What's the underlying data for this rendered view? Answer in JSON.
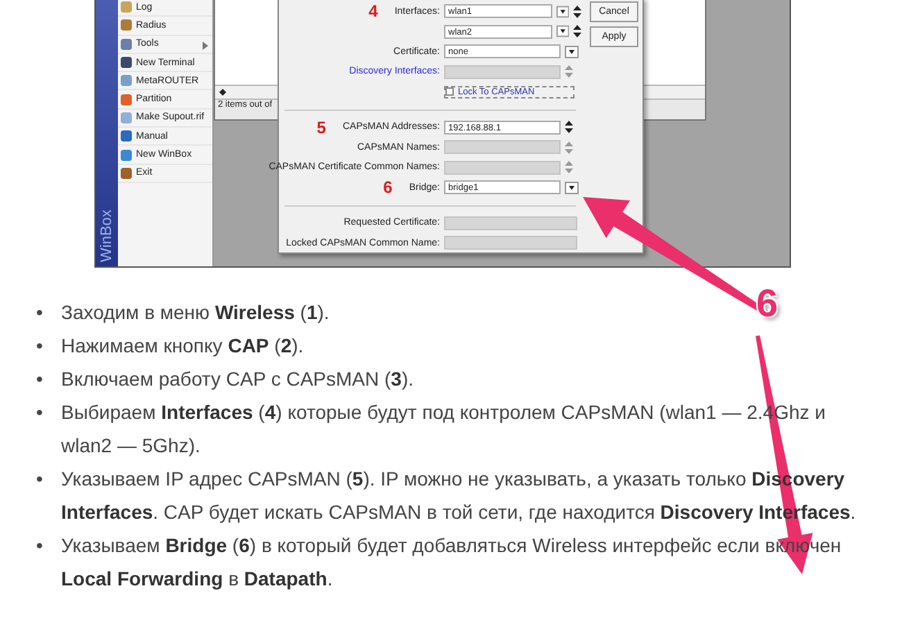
{
  "winbox": {
    "brand": "WinBox",
    "menu": [
      {
        "label": "Log",
        "submenu": false
      },
      {
        "label": "Radius",
        "submenu": false
      },
      {
        "label": "Tools",
        "submenu": true
      },
      {
        "label": "New Terminal",
        "submenu": false
      },
      {
        "label": "MetaROUTER",
        "submenu": false
      },
      {
        "label": "Partition",
        "submenu": false
      },
      {
        "label": "Make Supout.rif",
        "submenu": false
      },
      {
        "label": "Manual",
        "submenu": false
      },
      {
        "label": "New WinBox",
        "submenu": false
      },
      {
        "label": "Exit",
        "submenu": false
      }
    ],
    "list_window": {
      "status": "2 items out of"
    }
  },
  "dialog": {
    "rows": [
      {
        "kind": "dropdown",
        "number": "4",
        "label": "Interfaces:",
        "value": "wlan1",
        "disabled": false
      },
      {
        "kind": "dropdown",
        "value": "wlan2",
        "disabled": false
      },
      {
        "kind": "select",
        "label": "Certificate:",
        "value": "none",
        "disabled": false
      },
      {
        "kind": "spin",
        "link": "Discovery Interfaces:",
        "disabled": true
      },
      {
        "kind": "checkbox",
        "label": "Lock To CAPsMAN",
        "checked": false
      },
      {
        "kind": "separator"
      },
      {
        "kind": "spin",
        "number": "5",
        "label": "CAPsMAN Addresses:",
        "value": "192.168.88.1",
        "disabled": false
      },
      {
        "kind": "spin",
        "label": "CAPsMAN Names:",
        "disabled": true
      },
      {
        "kind": "spin",
        "label": "CAPsMAN Certificate Common Names:",
        "disabled": true
      },
      {
        "kind": "select",
        "number": "6",
        "label": "Bridge:",
        "value": "bridge1",
        "disabled": false
      },
      {
        "kind": "separator"
      },
      {
        "kind": "plain",
        "label": "Requested Certificate:",
        "disabled": true
      },
      {
        "kind": "plain",
        "label": "Locked CAPsMAN Common Name:",
        "disabled": true
      }
    ],
    "buttons": [
      "Cancel",
      "Apply"
    ]
  },
  "callout": {
    "number": "6"
  },
  "steps": [
    {
      "bullet": "•",
      "text": "Заходим в меню **Wireless** (**1**)."
    },
    {
      "bullet": "•",
      "text": "Нажимаем кнопку **CAP** (**2**)."
    },
    {
      "bullet": "•",
      "text": "Включаем работу CAP с CAPsMAN (**3**)."
    },
    {
      "bullet": "•",
      "text": "Выбираем **Interfaces** (**4**) которые будут под контролем CAPsMAN (wlan1 — 2.4Ghz и wlan2 — 5Ghz)."
    },
    {
      "bullet": "•",
      "text": "Указываем IP адрес CAPsMAN (**5**). IP можно не указывать, а указать только **Discovery Interfaces**. CAP будет искать CAPsMAN в той сети, где находится **Discovery Interfaces**."
    },
    {
      "bullet": "•",
      "text": "Указываем **Bridge** (**6**) в который будет добавляться Wireless интерфейс если включен **Local Forwarding** в **Datapath**."
    }
  ]
}
